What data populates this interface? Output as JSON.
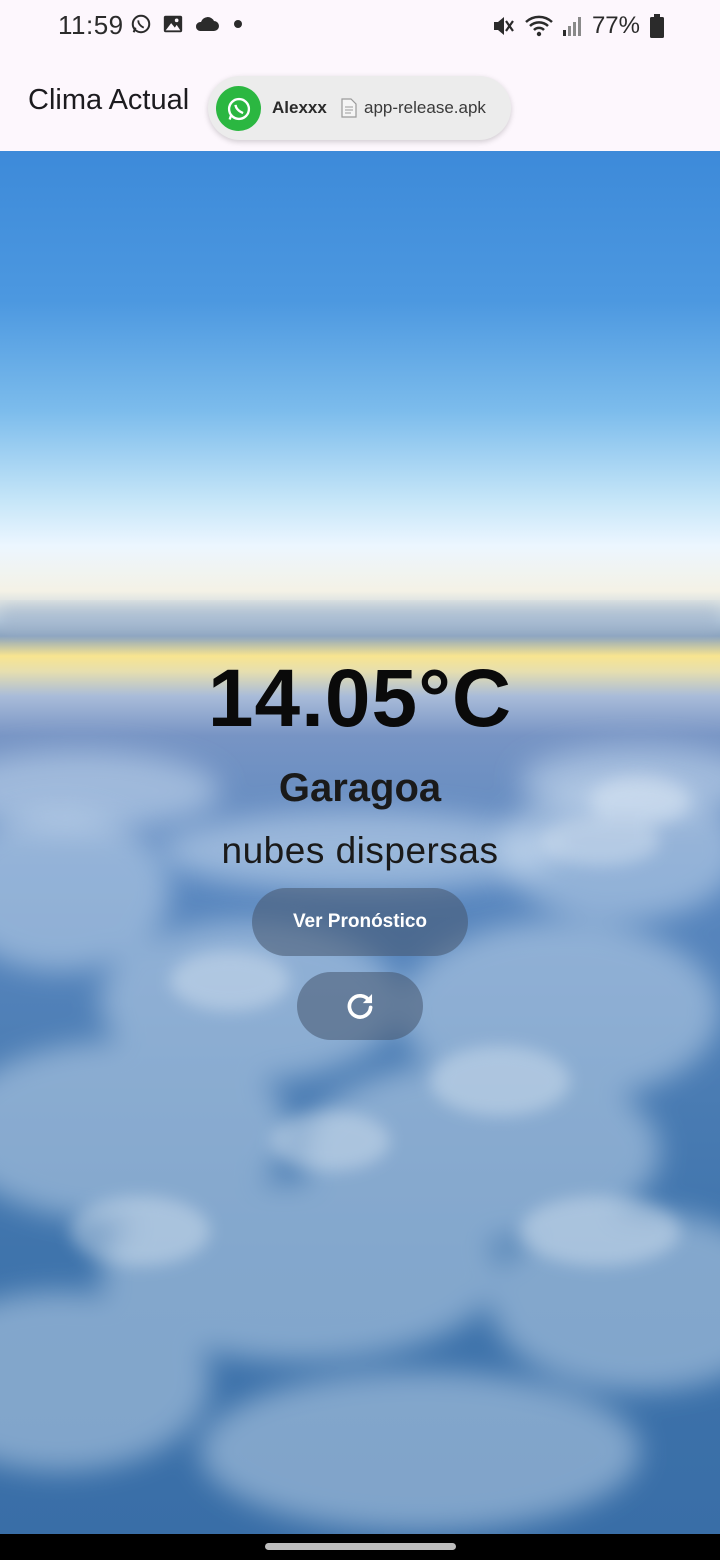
{
  "status_bar": {
    "time": "11:59",
    "battery": "77%",
    "left_icons": [
      "whatsapp-icon",
      "gallery-icon",
      "cloud-icon",
      "dot-icon"
    ],
    "right_icons": [
      "mute-icon",
      "wifi-icon",
      "signal-icon",
      "battery-icon"
    ]
  },
  "app_bar": {
    "title": "Clima Actual"
  },
  "notification": {
    "app_icon": "whatsapp-icon",
    "sender": "Alexxx",
    "file_icon": "document-icon",
    "message": "app-release.apk"
  },
  "weather": {
    "temperature": "14.05°C",
    "city": "Garagoa",
    "description": "nubes dispersas"
  },
  "buttons": {
    "forecast_label": "Ver Pronóstico",
    "refresh_icon": "refresh-icon"
  },
  "colors": {
    "app_bar_bg": "#fdf7fd",
    "button_bg": "#46556e",
    "whatsapp_green": "#2bb741"
  }
}
